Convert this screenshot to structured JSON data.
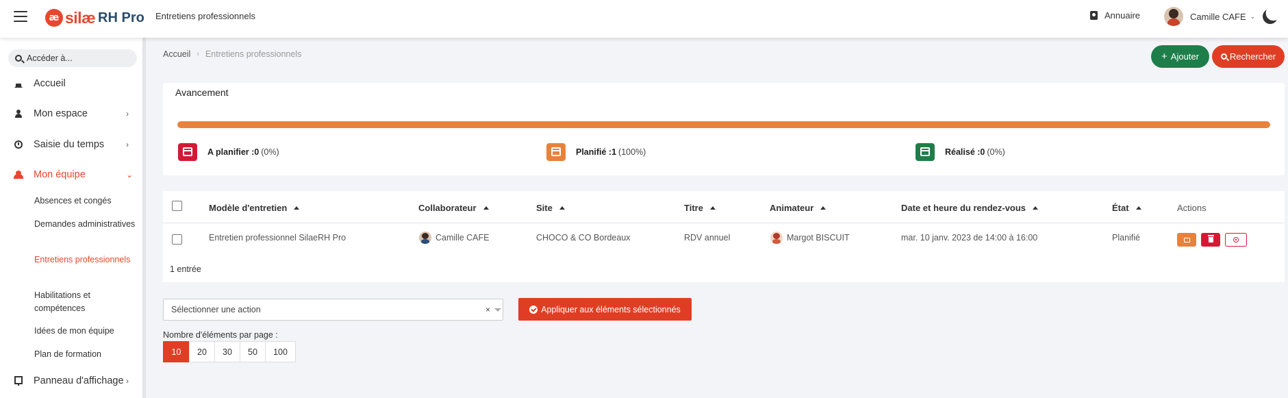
{
  "app": {
    "logo_mark": "æ",
    "logo_silae": "silæ",
    "logo_rh": "RH Pro",
    "module": "Entretiens professionnels"
  },
  "header": {
    "annuaire": "Annuaire",
    "user_name": "Camille CAFE"
  },
  "sidebar": {
    "search_placeholder": "Accéder à...",
    "items": [
      {
        "label": "Accueil"
      },
      {
        "label": "Mon espace"
      },
      {
        "label": "Saisie du temps"
      },
      {
        "label": "Mon équipe"
      },
      {
        "label": "Panneau d'affichage"
      }
    ],
    "sub_items": [
      {
        "label": "Absences et congés"
      },
      {
        "label": "Demandes administratives"
      },
      {
        "label": "Entretiens professionnels"
      },
      {
        "label": "Habilitations et compétences"
      },
      {
        "label": "Idées de mon équipe"
      },
      {
        "label": "Plan de formation"
      }
    ]
  },
  "breadcrumb": {
    "home": "Accueil",
    "current": "Entretiens professionnels"
  },
  "toolbar": {
    "add_label": "Ajouter",
    "search_label": "Rechercher"
  },
  "progress": {
    "title": "Avancement",
    "fill_percent": 100,
    "stats": [
      {
        "label": "A planifier : ",
        "count": "0",
        "pct": "(0%)",
        "color": "#d31a35"
      },
      {
        "label": "Planifié : ",
        "count": "1",
        "pct": "(100%)",
        "color": "#e8823b"
      },
      {
        "label": "Réalisé : ",
        "count": "0",
        "pct": "(0%)",
        "color": "#1e7e4a"
      }
    ]
  },
  "table": {
    "headers": {
      "model": "Modèle d'entretien",
      "collaborator": "Collaborateur",
      "site": "Site",
      "title": "Titre",
      "animator": "Animateur",
      "date": "Date et heure du rendez-vous",
      "state": "État",
      "actions": "Actions"
    },
    "rows": [
      {
        "model": "Entretien professionnel SilaeRH Pro",
        "collaborator": "Camille CAFE",
        "site": "CHOCO & CO Bordeaux",
        "title": "RDV annuel",
        "animator": "Margot BISCUIT",
        "date": "mar. 10 janv. 2023 de 14:00 à 16:00",
        "state": "Planifié"
      }
    ],
    "count": "1 entrée"
  },
  "bulk": {
    "select_placeholder": "Sélectionner une action",
    "clear": "×",
    "apply_label": "Appliquer aux éléments sélectionnés"
  },
  "pagination": {
    "label": "Nombre d'éléments par page :",
    "sizes": [
      "10",
      "20",
      "30",
      "50",
      "100"
    ],
    "selected": "10"
  }
}
